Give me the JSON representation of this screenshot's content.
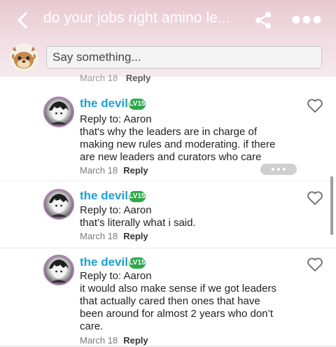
{
  "header": {
    "title": "do your jobs right amino le...",
    "input_placeholder": "Say something..."
  },
  "colors": {
    "accent": "#1f9fd3",
    "level_badge": "#2fa84a",
    "header_tint": "#e8c9d2"
  },
  "previous": {
    "date": "March 18",
    "reply_label": "Reply"
  },
  "comments": [
    {
      "author": "the devil",
      "level": "LV15",
      "reply_to": "Reply to: Aaron",
      "lines": [
        "that's why the leaders are in charge of",
        "making new rules and moderating. if there",
        "are new leaders and curators who care"
      ],
      "date": "March 18",
      "reply_label": "Reply"
    },
    {
      "author": "the devil",
      "level": "LV15",
      "reply_to": "Reply to: Aaron",
      "lines": [
        "that’s literally what i said."
      ],
      "date": "March 18",
      "reply_label": "Reply"
    },
    {
      "author": "the devil",
      "level": "LV15",
      "reply_to": "Reply to: Aaron",
      "lines": [
        "it would also make sense if we got leaders",
        "that actually cared then ones that have",
        "been around for almost 2 years who don’t",
        "care."
      ],
      "date": "March 18",
      "reply_label": "Reply"
    }
  ],
  "icons": {
    "back": "chevron-left-icon",
    "share": "share-icon",
    "more": "more-icon",
    "like": "heart-icon"
  }
}
